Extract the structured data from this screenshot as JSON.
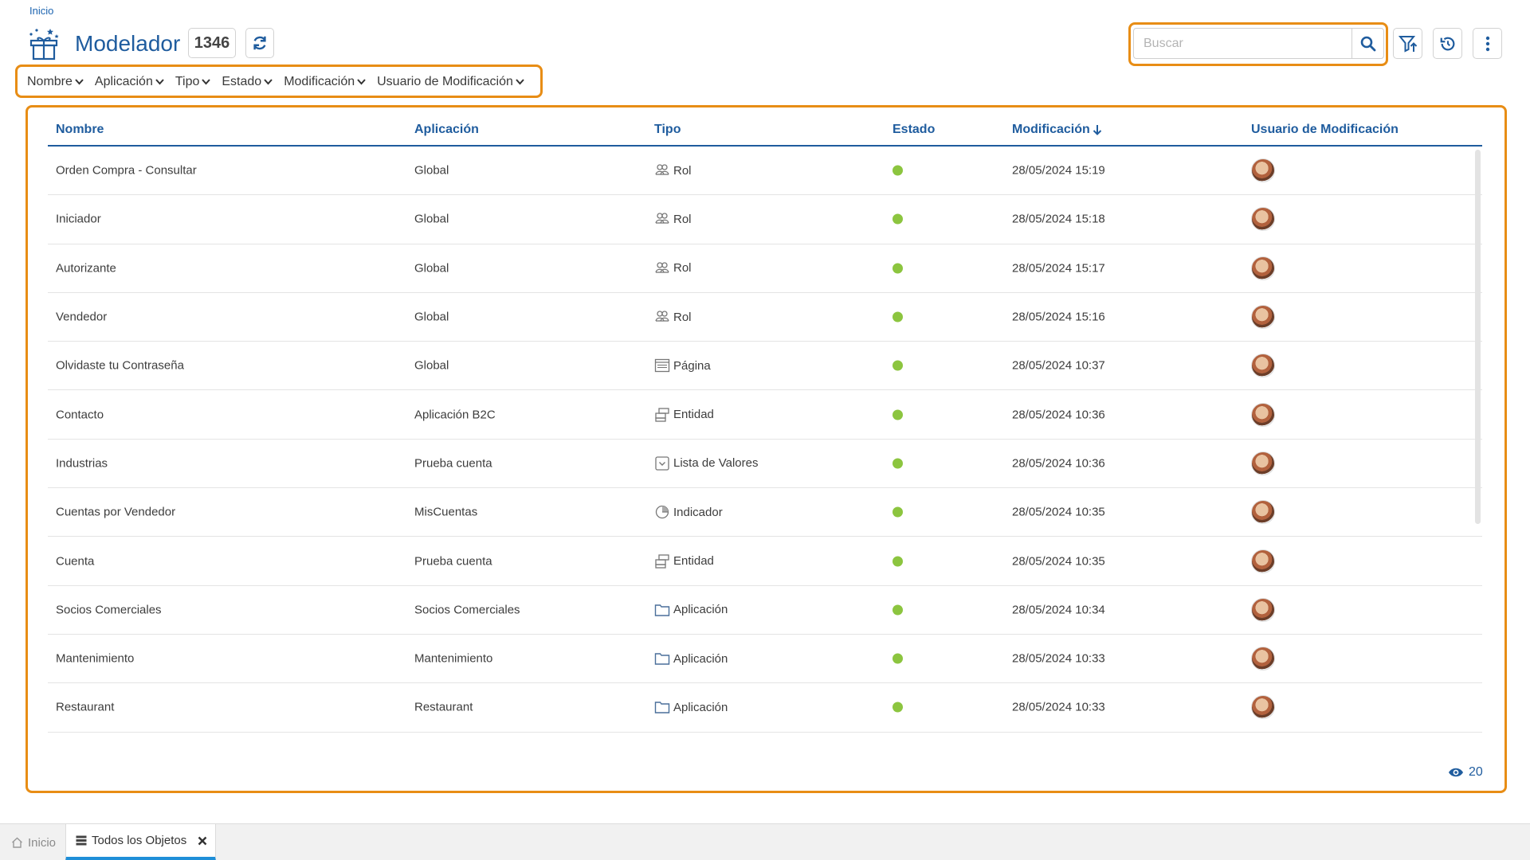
{
  "breadcrumb": "Inicio",
  "title": "Modelador",
  "count": "1346",
  "filters": [
    "Nombre",
    "Aplicación",
    "Tipo",
    "Estado",
    "Modificación",
    "Usuario de Modificación"
  ],
  "search": {
    "placeholder": "Buscar"
  },
  "columns": {
    "nombre": "Nombre",
    "aplicacion": "Aplicación",
    "tipo": "Tipo",
    "estado": "Estado",
    "modificacion": "Modificación",
    "usuario": "Usuario de Modificación"
  },
  "rows": [
    {
      "nombre": "Orden Compra - Consultar",
      "aplicacion": "Global",
      "tipo": "Rol",
      "icon": "role-icon",
      "fecha": "28/05/2024 15:19"
    },
    {
      "nombre": "Iniciador",
      "aplicacion": "Global",
      "tipo": "Rol",
      "icon": "role-icon",
      "fecha": "28/05/2024 15:18"
    },
    {
      "nombre": "Autorizante",
      "aplicacion": "Global",
      "tipo": "Rol",
      "icon": "role-icon",
      "fecha": "28/05/2024 15:17"
    },
    {
      "nombre": "Vendedor",
      "aplicacion": "Global",
      "tipo": "Rol",
      "icon": "role-icon",
      "fecha": "28/05/2024 15:16"
    },
    {
      "nombre": "Olvidaste tu Contraseña",
      "aplicacion": "Global",
      "tipo": "Página",
      "icon": "page-icon",
      "fecha": "28/05/2024 10:37"
    },
    {
      "nombre": "Contacto",
      "aplicacion": "Aplicación B2C",
      "tipo": "Entidad",
      "icon": "entity-icon",
      "fecha": "28/05/2024 10:36"
    },
    {
      "nombre": "Industrias",
      "aplicacion": "Prueba cuenta",
      "tipo": "Lista de Valores",
      "icon": "list-icon",
      "fecha": "28/05/2024 10:36"
    },
    {
      "nombre": "Cuentas por Vendedor",
      "aplicacion": "MisCuentas",
      "tipo": "Indicador",
      "icon": "indicator-icon",
      "fecha": "28/05/2024 10:35"
    },
    {
      "nombre": "Cuenta",
      "aplicacion": "Prueba cuenta",
      "tipo": "Entidad",
      "icon": "entity-icon",
      "fecha": "28/05/2024 10:35"
    },
    {
      "nombre": "Socios Comerciales",
      "aplicacion": "Socios Comerciales",
      "tipo": "Aplicación",
      "icon": "folder-icon",
      "fecha": "28/05/2024 10:34"
    },
    {
      "nombre": "Mantenimiento",
      "aplicacion": "Mantenimiento",
      "tipo": "Aplicación",
      "icon": "folder-icon",
      "fecha": "28/05/2024 10:33"
    },
    {
      "nombre": "Restaurant",
      "aplicacion": "Restaurant",
      "tipo": "Aplicación",
      "icon": "folder-icon",
      "fecha": "28/05/2024 10:33"
    }
  ],
  "visible_count": "20",
  "bottom_tabs": {
    "home": "Inicio",
    "current": "Todos los Objetos"
  },
  "colors": {
    "accent": "#1f5c9e",
    "highlight": "#e88d15",
    "status_active": "#8cc53f",
    "tab_indicator": "#1f8fd8"
  }
}
